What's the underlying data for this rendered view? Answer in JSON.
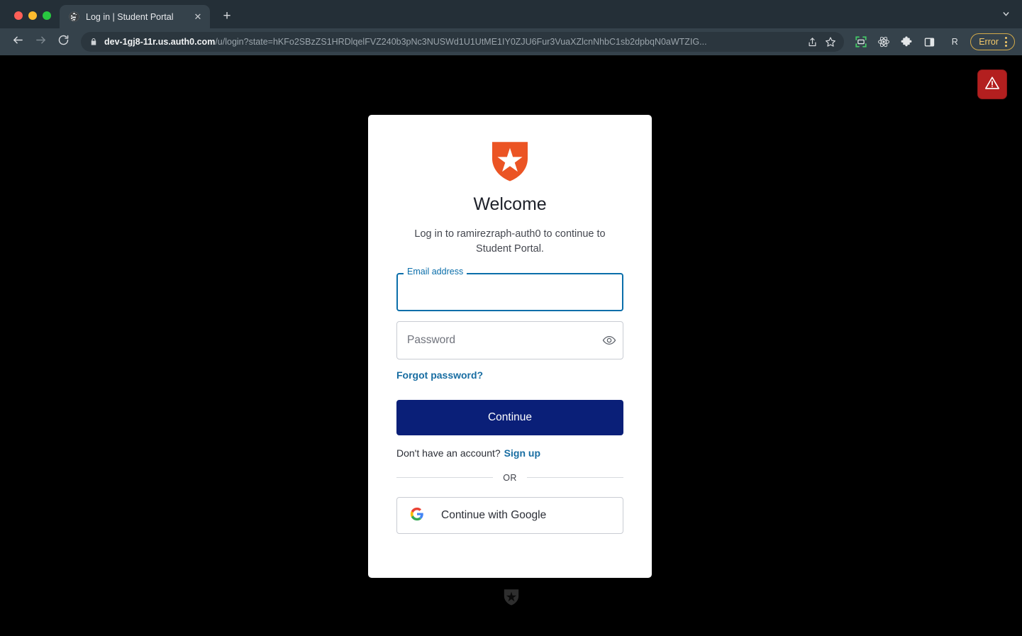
{
  "browser": {
    "window_controls": [
      "close",
      "minimize",
      "maximize"
    ],
    "tab": {
      "title": "Log in | Student Portal",
      "favicon": "globe-icon",
      "close_label": "✕"
    },
    "new_tab_label": "+",
    "tab_search_icon": "chevron-down-icon",
    "nav": {
      "back_icon": "arrow-left-icon",
      "forward_icon": "arrow-right-icon",
      "reload_icon": "reload-icon"
    },
    "omnibox": {
      "lock_icon": "lock-icon",
      "url_host": "dev-1gj8-11r.us.auth0.com",
      "url_path": "/u/login?state=hKFo2SBzZS1HRDlqelFVZ240b3pNc3NUSWd1U1UtME1IY0ZJU6Fur3VuaXZlcnNhbC1sb2dpbqN0aWTZIG...",
      "share_icon": "share-icon",
      "bookmark_icon": "star-icon"
    },
    "toolbar_icons": [
      {
        "name": "screenshot-capture-icon",
        "glyph": "capture"
      },
      {
        "name": "react-devtools-icon",
        "glyph": "atom"
      },
      {
        "name": "extensions-icon",
        "glyph": "puzzle"
      },
      {
        "name": "side-panel-icon",
        "glyph": "panel"
      }
    ],
    "profile_initial": "R",
    "error_pill": {
      "label": "Error",
      "menu_icon": "kebab-menu-icon",
      "border_color": "#d4ab4a",
      "text_color": "#f3c96b"
    }
  },
  "page": {
    "background_color": "#000000",
    "warning_badge": {
      "name": "warning-triangle-icon",
      "background_color": "#b31f1f"
    },
    "card": {
      "logo_alt": "auth0-logo",
      "logo_color": "#eb5424",
      "heading": "Welcome",
      "subtitle": "Log in to ramirezraph-auth0 to continue to Student Portal.",
      "email": {
        "label": "Email address",
        "value": "",
        "placeholder": "",
        "focus_color": "#0a6eaa"
      },
      "password": {
        "placeholder": "Password",
        "value": "",
        "toggle_icon": "eye-icon"
      },
      "forgot_password_label": "Forgot password?",
      "continue_label": "Continue",
      "continue_color": "#0a1f78",
      "signup_prompt": "Don't have an account?",
      "signup_label": "Sign up",
      "divider_label": "OR",
      "google_button_label": "Continue with Google",
      "google_icon": "google-g-icon",
      "link_color": "#186da2"
    },
    "footer_logo": "auth0-shield-icon"
  }
}
